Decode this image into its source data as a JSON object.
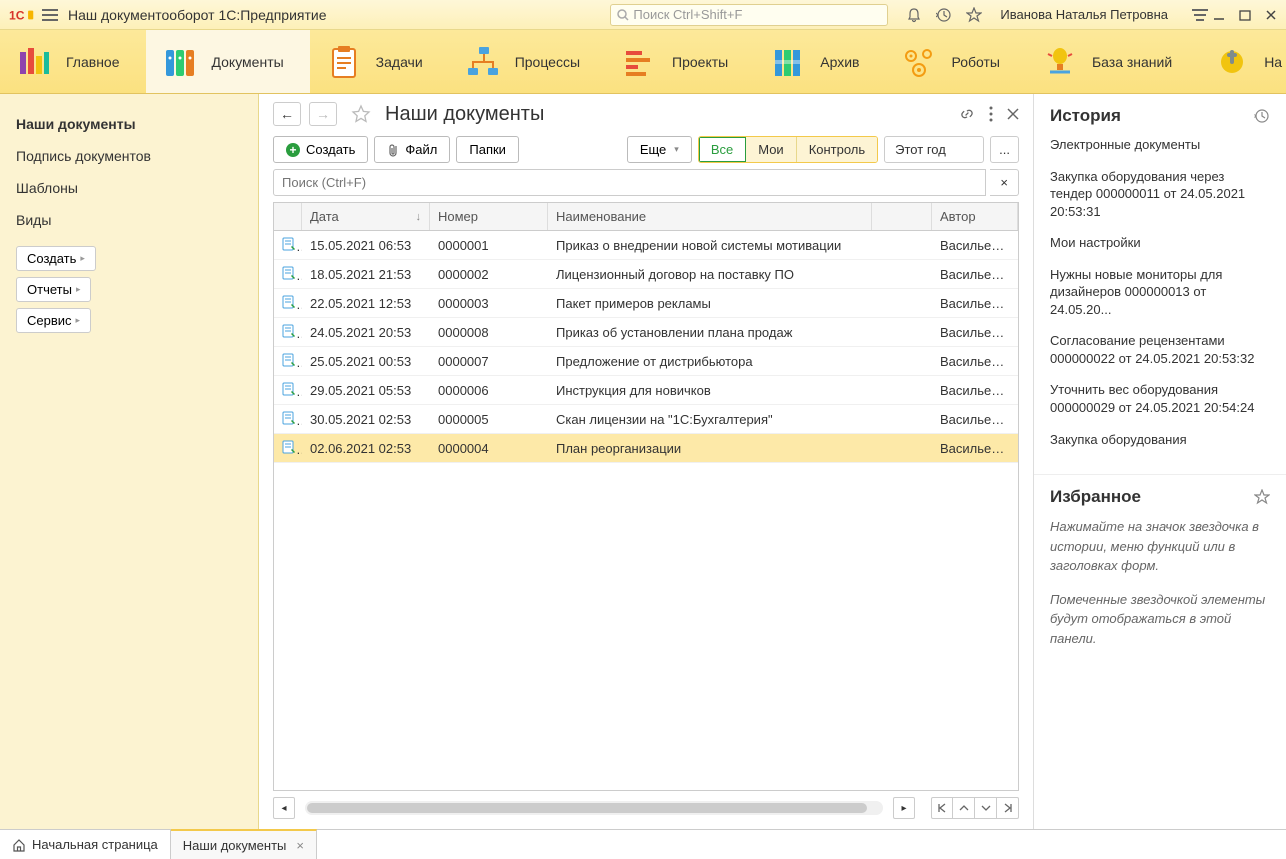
{
  "titlebar": {
    "app_title": "Наш документооборот 1С:Предприятие",
    "search_placeholder": "Поиск Ctrl+Shift+F",
    "user_name": "Иванова Наталья Петровна"
  },
  "ribbon": {
    "tabs": [
      {
        "label": "Главное",
        "icon": "home-icon"
      },
      {
        "label": "Документы",
        "icon": "docs-icon",
        "active": true
      },
      {
        "label": "Задачи",
        "icon": "tasks-icon"
      },
      {
        "label": "Процессы",
        "icon": "processes-icon"
      },
      {
        "label": "Проекты",
        "icon": "projects-icon"
      },
      {
        "label": "Архив",
        "icon": "archive-icon"
      },
      {
        "label": "Роботы",
        "icon": "robots-icon"
      },
      {
        "label": "База знаний",
        "icon": "knowledge-icon"
      },
      {
        "label": "На",
        "icon": "settings-icon"
      }
    ]
  },
  "sidebar_left": {
    "items": [
      {
        "label": "Наши документы",
        "active": true
      },
      {
        "label": "Подпись документов"
      },
      {
        "label": "Шаблоны"
      },
      {
        "label": "Виды"
      }
    ],
    "buttons": {
      "create": "Создать",
      "reports": "Отчеты",
      "service": "Сервис"
    }
  },
  "content": {
    "page_title": "Наши документы",
    "toolbar": {
      "create": "Создать",
      "file": "Файл",
      "folders": "Папки",
      "more": "Еще",
      "filter_all": "Все",
      "filter_mine": "Мои",
      "filter_control": "Контроль",
      "period": "Этот год",
      "dots": "..."
    },
    "search_placeholder": "Поиск (Ctrl+F)",
    "columns": {
      "date": "Дата",
      "number": "Номер",
      "name": "Наименование",
      "author": "Автор"
    },
    "rows": [
      {
        "date": "15.05.2021 06:53",
        "number": "0000001",
        "name": "Приказ о внедрении новой системы мотивации",
        "author": "Васильев А"
      },
      {
        "date": "18.05.2021 21:53",
        "number": "0000002",
        "name": "Лицензионный договор на поставку ПО",
        "author": "Васильев А"
      },
      {
        "date": "22.05.2021 12:53",
        "number": "0000003",
        "name": "Пакет примеров рекламы",
        "author": "Васильев А"
      },
      {
        "date": "24.05.2021 20:53",
        "number": "0000008",
        "name": "Приказ об установлении плана продаж",
        "author": "Васильев А"
      },
      {
        "date": "25.05.2021 00:53",
        "number": "0000007",
        "name": "Предложение от дистрибьютора",
        "author": "Васильев А"
      },
      {
        "date": "29.05.2021 05:53",
        "number": "0000006",
        "name": "Инструкция для новичков",
        "author": "Васильев А"
      },
      {
        "date": "30.05.2021 02:53",
        "number": "0000005",
        "name": "Скан лицензии на \"1С:Бухгалтерия\"",
        "author": "Васильев А"
      },
      {
        "date": "02.06.2021 02:53",
        "number": "0000004",
        "name": "План реорганизации",
        "author": "Васильев А",
        "selected": true
      }
    ]
  },
  "history": {
    "title": "История",
    "items": [
      "Электронные документы",
      "Закупка оборудования через тендер 000000011 от 24.05.2021 20:53:31",
      "Мои настройки",
      "Нужны новые мониторы для дизайнеров 000000013 от 24.05.20...",
      "Согласование рецензентами 000000022 от 24.05.2021 20:53:32",
      "Уточнить вес оборудования 000000029 от 24.05.2021 20:54:24",
      "Закупка оборудования"
    ]
  },
  "favorites": {
    "title": "Избранное",
    "hint1": "Нажимайте на значок звездочка в истории, меню функций или в заголовках форм.",
    "hint2": "Помеченные звездочкой элементы будут отображаться в этой панели."
  },
  "bottom_tabs": {
    "home": "Начальная страница",
    "current": "Наши документы"
  }
}
